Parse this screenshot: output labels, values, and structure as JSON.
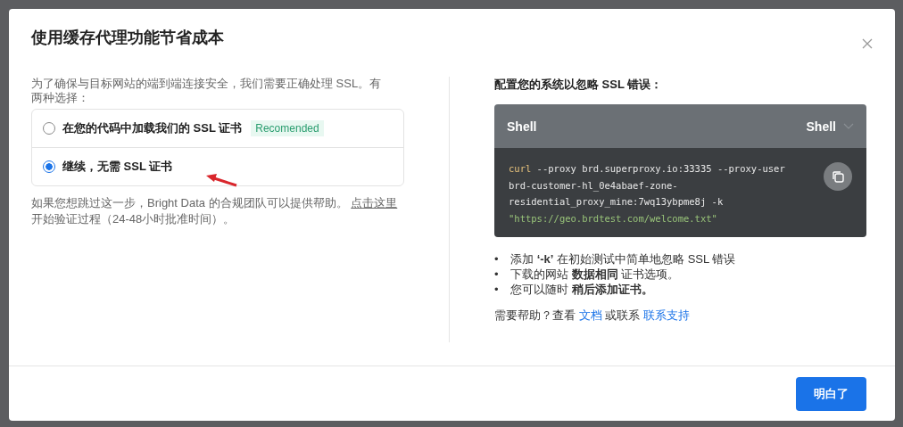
{
  "dialog": {
    "title": "使用缓存代理功能节省成本",
    "intro": "为了确保与目标网站的端到端连接安全，我们需要正确处理 SSL。有两种选择：",
    "options": [
      {
        "label": "在您的代码中加载我们的 SSL 证书",
        "badge": "Recomended",
        "selected": false
      },
      {
        "label": "继续，无需 SSL 证书",
        "selected": true
      }
    ],
    "note": "如果您想跳过这一步，Bright Data 的合规团队可以提供帮助。",
    "note_link": "点击这里",
    "note_tail": "开始验证过程（24-48小时批准时间）。",
    "config_title": "配置您的系统以忽略 SSL 错误：",
    "code_block": {
      "title": "Shell",
      "language": "Shell",
      "lines": [
        [
          {
            "kind": "keyword",
            "text": "curl"
          },
          {
            "kind": "plain",
            "text": " --proxy brd.superproxy.io:33335 --proxy-user"
          }
        ],
        [
          {
            "kind": "plain",
            "text": "brd-customer-hl_0e4abaef-zone-"
          }
        ],
        [
          {
            "kind": "plain",
            "text": "residential_proxy_mine:7wq13ybpme8j -k"
          }
        ],
        [
          {
            "kind": "string",
            "text": "\"https://geo.brdtest.com/welcome.txt\""
          }
        ]
      ]
    },
    "tips": [
      {
        "bullet": "•",
        "text": "添加 **‘-k’** 在初始测试中简单地忽略 SSL 错误"
      },
      {
        "bullet": "•",
        "text": "下载的网站 **数据相同** 证书选项。"
      },
      {
        "bullet": "•",
        "text": "您可以随时 **稍后添加证书。**"
      }
    ],
    "help": {
      "text": "需要帮助？查看",
      "link1": "文档",
      "middle": "或联系",
      "link2": "联系支持"
    },
    "button": "明白了"
  }
}
